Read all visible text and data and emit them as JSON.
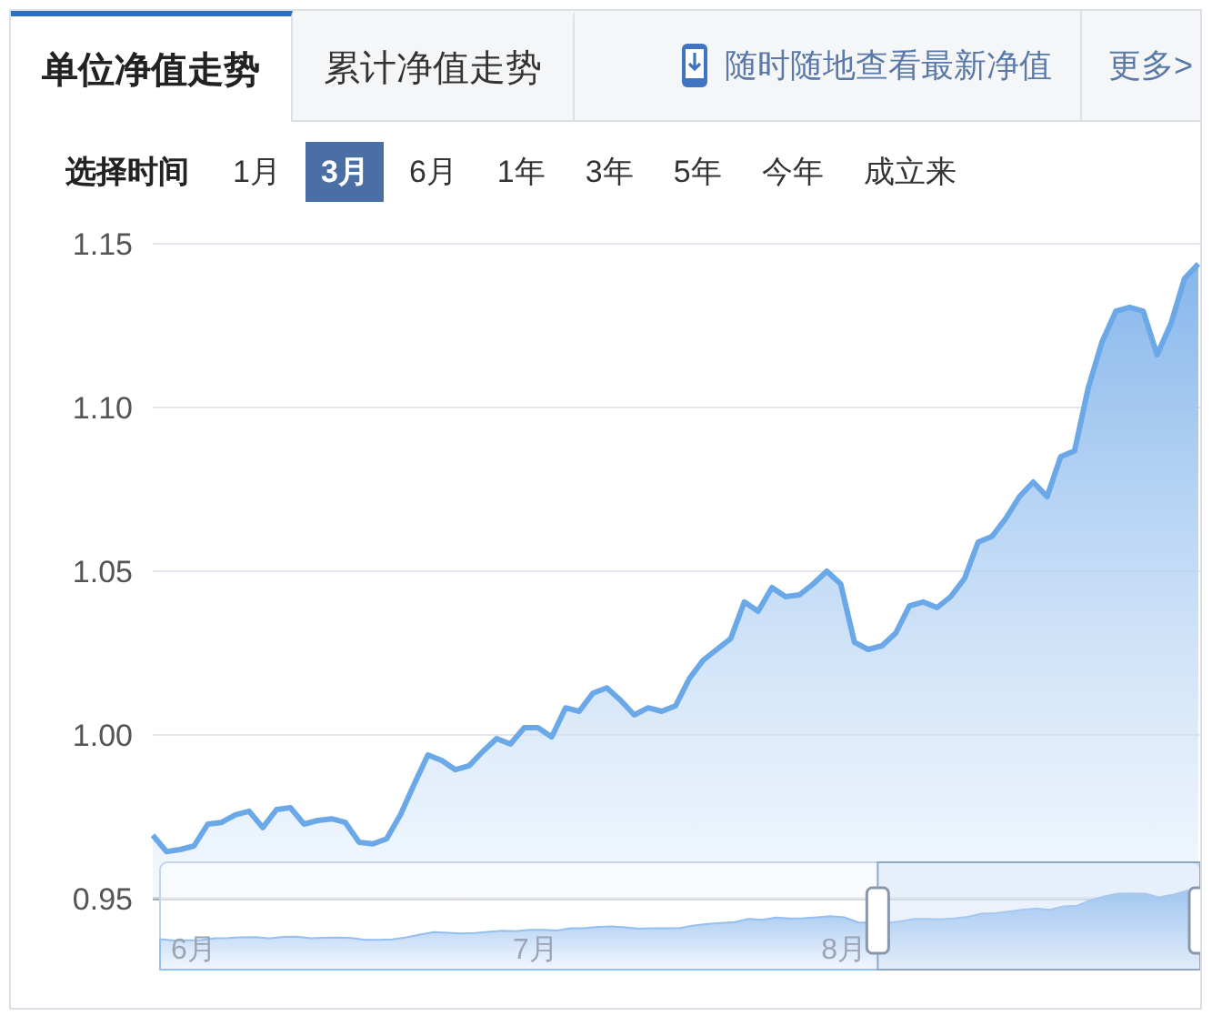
{
  "tabs": [
    {
      "label": "单位净值走势",
      "selected": true
    },
    {
      "label": "累计净值走势",
      "selected": false
    }
  ],
  "promo": {
    "text": "随时随地查看最新净值"
  },
  "more_link": "更多>",
  "time_filter": {
    "label": "选择时间",
    "options": [
      {
        "label": "1月",
        "selected": false
      },
      {
        "label": "3月",
        "selected": true
      },
      {
        "label": "6月",
        "selected": false
      },
      {
        "label": "1年",
        "selected": false
      },
      {
        "label": "3年",
        "selected": false
      },
      {
        "label": "5年",
        "selected": false
      },
      {
        "label": "今年",
        "selected": false
      },
      {
        "label": "成立来",
        "selected": false
      }
    ]
  },
  "chart": {
    "chart_data": {
      "type": "area",
      "grid": true,
      "ylim": [
        0.95,
        1.15
      ],
      "yticks": [
        {
          "value": 0.95,
          "label": "0.95"
        },
        {
          "value": 1.0,
          "label": "1.00"
        },
        {
          "value": 1.05,
          "label": "1.05"
        },
        {
          "value": 1.1,
          "label": "1.10"
        },
        {
          "value": 1.15,
          "label": "1.15"
        }
      ],
      "values": [
        0.9694,
        0.9644,
        0.965,
        0.9661,
        0.9728,
        0.9733,
        0.9756,
        0.9767,
        0.9717,
        0.9772,
        0.9778,
        0.9728,
        0.9739,
        0.9744,
        0.9733,
        0.9672,
        0.9667,
        0.9683,
        0.9756,
        0.985,
        0.9939,
        0.9922,
        0.9894,
        0.9906,
        0.995,
        0.9989,
        0.9972,
        1.0022,
        1.0022,
        0.9994,
        1.0083,
        1.0072,
        1.0128,
        1.0144,
        1.0106,
        1.0061,
        1.0083,
        1.0072,
        1.0089,
        1.0172,
        1.0228,
        1.0261,
        1.0294,
        1.0406,
        1.0378,
        1.045,
        1.0422,
        1.0428,
        1.0461,
        1.05,
        1.0461,
        1.0283,
        1.0261,
        1.0272,
        1.0311,
        1.0394,
        1.0406,
        1.0389,
        1.0422,
        1.0478,
        1.0589,
        1.0606,
        1.0661,
        1.0728,
        1.0772,
        1.0728,
        1.085,
        1.0867,
        1.1061,
        1.12,
        1.1294,
        1.1306,
        1.1294,
        1.1161,
        1.1256,
        1.1394,
        1.1439
      ]
    }
  },
  "zoom_slider": {
    "labels": [
      "6月",
      "7月",
      "8月"
    ],
    "handles": [
      {
        "level": 0.69
      },
      {
        "level": 1.0
      }
    ]
  }
}
